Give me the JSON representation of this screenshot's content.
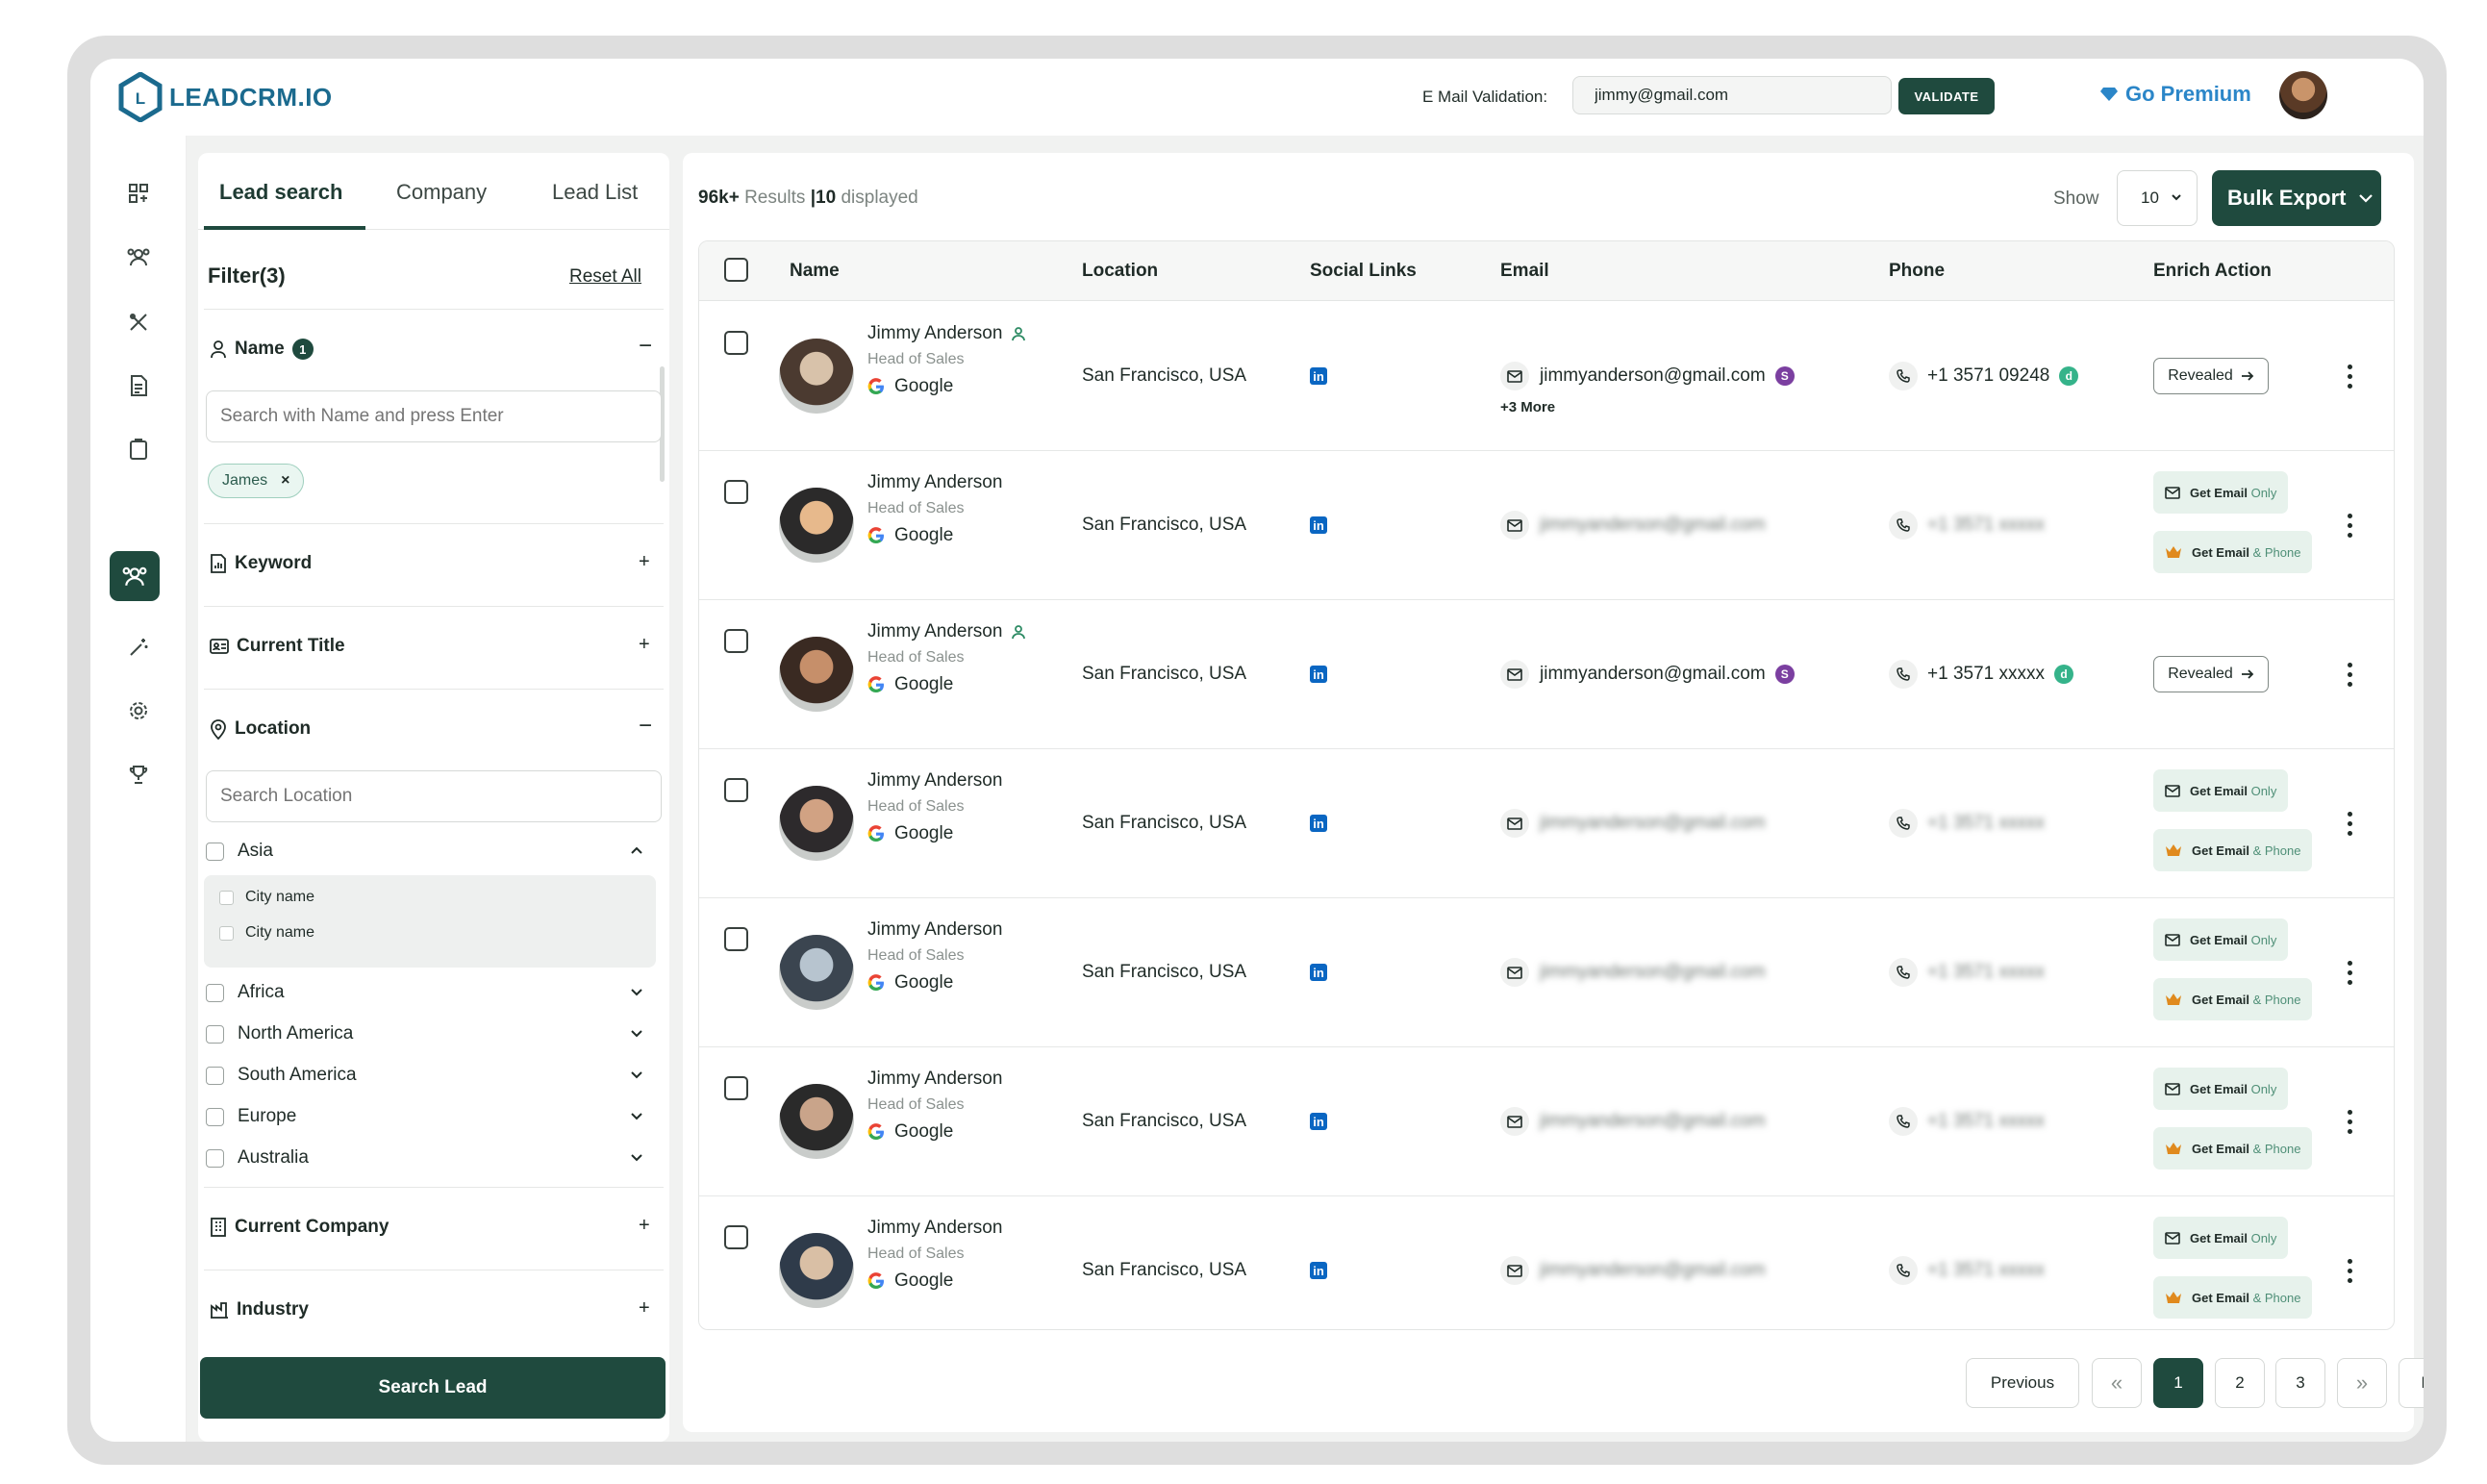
{
  "brand": {
    "name": "LEADCRM.IO",
    "logo_mark": "LC"
  },
  "topbar": {
    "email_validation_label": "E Mail Validation:",
    "email_validation_value": "jimmy@gmail.com",
    "validate_label": "VALIDATE",
    "premium_label": "Go Premium"
  },
  "rail": {
    "items": [
      "dashboard-icon",
      "team-icon",
      "tools-icon",
      "report-icon",
      "clipboard-icon",
      "leads-icon",
      "magic-icon",
      "settings-icon",
      "trophy-icon"
    ],
    "active": "leads-icon"
  },
  "filters": {
    "tabs": [
      "Lead search",
      "Company",
      "Lead List"
    ],
    "title": "Filter(3)",
    "reset_label": "Reset All",
    "name": {
      "label": "Name",
      "count": "1",
      "toggle": "−",
      "placeholder": "Search with Name and press Enter",
      "chip": "James",
      "chip_close": "×"
    },
    "keyword": {
      "label": "Keyword",
      "toggle": "+"
    },
    "current_title": {
      "label": "Current Title",
      "toggle": "+"
    },
    "location": {
      "label": "Location",
      "toggle": "−",
      "placeholder": "Search Location",
      "regions": [
        "Asia",
        "Africa",
        "North America",
        "South America",
        "Europe",
        "Australia"
      ],
      "asia_cities": [
        "City name",
        "City name"
      ]
    },
    "current_company": {
      "label": "Current Company",
      "toggle": "+"
    },
    "industry": {
      "label": "Industry",
      "toggle": "+"
    },
    "search_button": "Search Lead"
  },
  "results": {
    "total": "96k+",
    "results_word": "Results",
    "separator": "|",
    "displayed": "10",
    "displayed_word": "displayed",
    "show_label": "Show",
    "show_value": "10",
    "bulk_export": "Bulk Export",
    "columns": [
      "Name",
      "Location",
      "Social Links",
      "Email",
      "Phone",
      "Enrich Action"
    ],
    "rows": [
      {
        "name": "Jimmy Anderson",
        "title": "Head of Sales",
        "company": "Google",
        "location": "San Francisco, USA",
        "email": "jimmyanderson@gmail.com",
        "phone": "+1 3571 09248",
        "revealed": true,
        "more": "+3 More",
        "verified_person": true
      },
      {
        "name": "Jimmy Anderson",
        "title": "Head of Sales",
        "company": "Google",
        "location": "San Francisco, USA",
        "email": "jimmyanderson@gmail.com",
        "phone": "+1 3571 xxxxx",
        "revealed": false
      },
      {
        "name": "Jimmy Anderson",
        "title": "Head of Sales",
        "company": "Google",
        "location": "San Francisco, USA",
        "email": "jimmyanderson@gmail.com",
        "phone": "+1 3571 xxxxx",
        "revealed": true,
        "verified_person": true
      },
      {
        "name": "Jimmy Anderson",
        "title": "Head of Sales",
        "company": "Google",
        "location": "San Francisco, USA",
        "email": "jimmyanderson@gmail.com",
        "phone": "+1 3571 xxxxx",
        "revealed": false
      },
      {
        "name": "Jimmy Anderson",
        "title": "Head of Sales",
        "company": "Google",
        "location": "San Francisco, USA",
        "email": "jimmyanderson@gmail.com",
        "phone": "+1 3571 xxxxx",
        "revealed": false
      },
      {
        "name": "Jimmy Anderson",
        "title": "Head of Sales",
        "company": "Google",
        "location": "San Francisco, USA",
        "email": "jimmyanderson@gmail.com",
        "phone": "+1 3571 xxxxx",
        "revealed": false
      },
      {
        "name": "Jimmy Anderson",
        "title": "Head of Sales",
        "company": "Google",
        "location": "San Francisco, USA",
        "email": "jimmyanderson@gmail.com",
        "phone": "+1 3571 xxxxx",
        "revealed": false
      }
    ],
    "revealed_label": "Revealed",
    "get_email_label": "Get Email",
    "get_email_suffix": "Only",
    "get_email_phone_label": "Get Email",
    "get_email_phone_suffix": "& Phone",
    "email_badge": "S",
    "phone_badge": "d"
  },
  "pagination": {
    "previous": "Previous",
    "first": "«",
    "pages": [
      "1",
      "2",
      "3"
    ],
    "last": "»",
    "next": "Next",
    "current": "1"
  },
  "colors": {
    "primary": "#1f4a3e",
    "accent_blue": "#2b86c8",
    "linkedin": "#0a66c2",
    "get_bg": "#e7f2ec"
  }
}
